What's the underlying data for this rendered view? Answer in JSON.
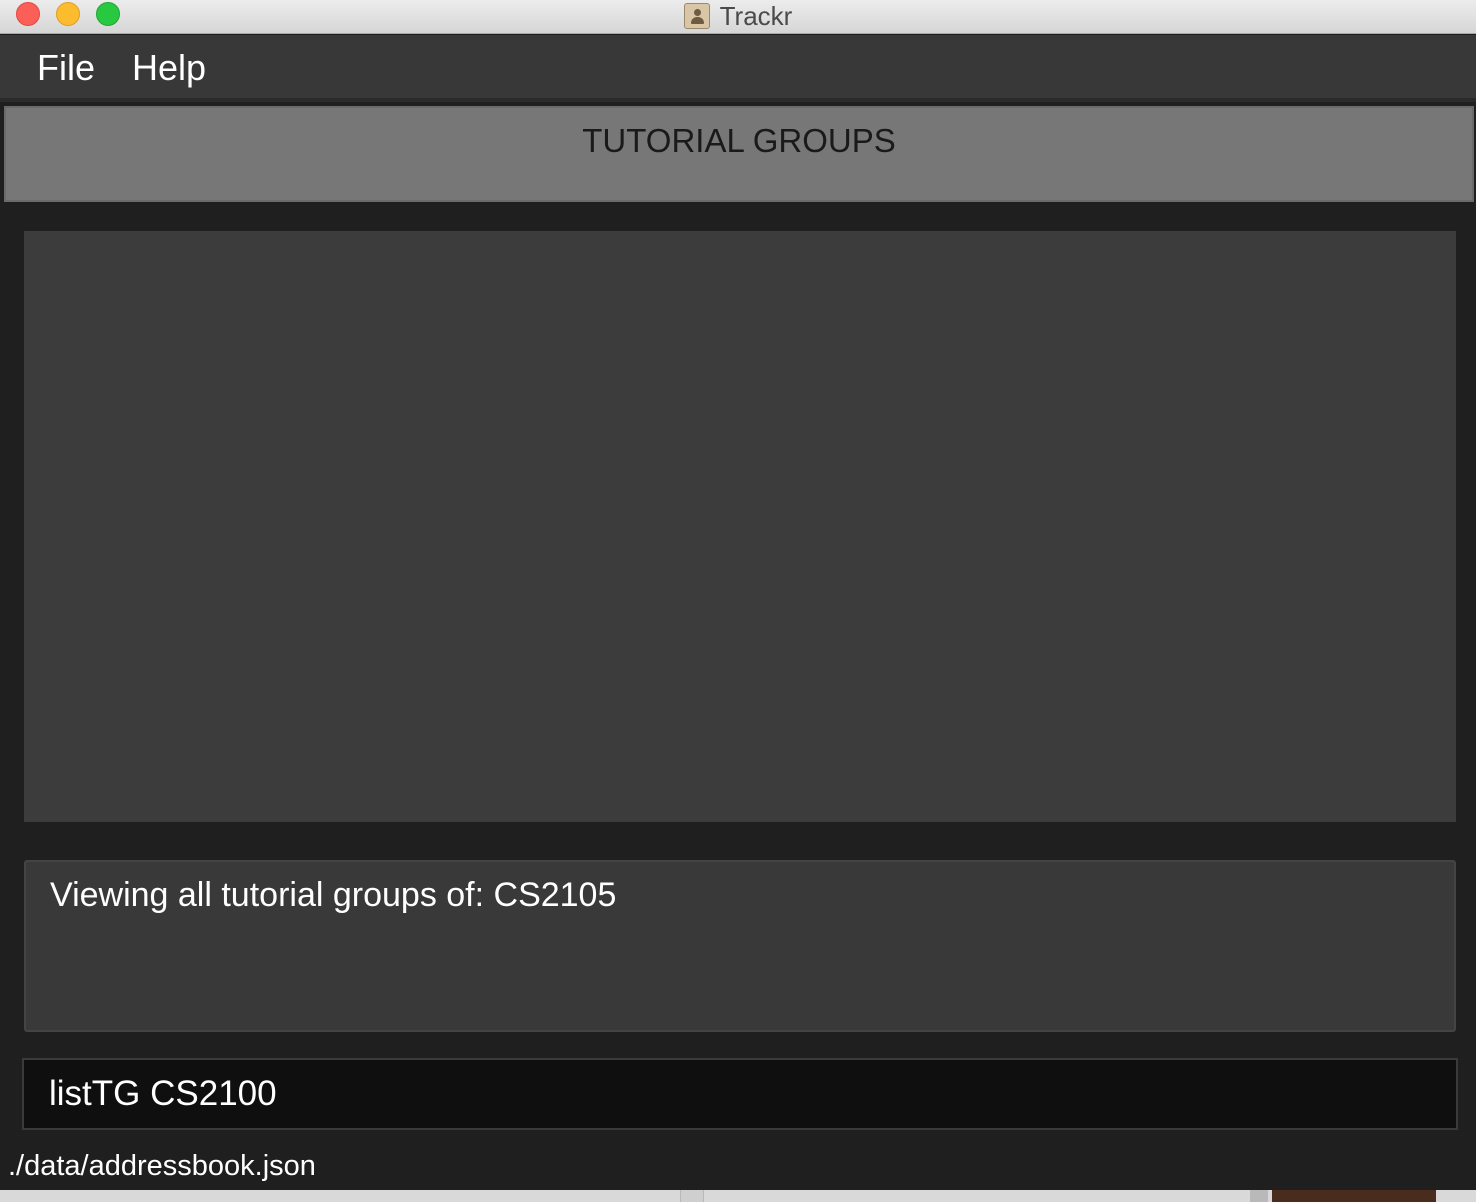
{
  "window": {
    "title": "Trackr"
  },
  "menu": {
    "file_label": "File",
    "help_label": "Help"
  },
  "section": {
    "title": "TUTORIAL GROUPS"
  },
  "result": {
    "message": "Viewing all tutorial groups of: CS2105"
  },
  "command": {
    "value": "listTG CS2100"
  },
  "status": {
    "file_path": "./data/addressbook.json"
  },
  "colors": {
    "menubar_bg": "#383838",
    "header_bg": "#777777",
    "panel_bg": "#3c3c3c",
    "command_bg": "#0f0f0f",
    "window_bg": "#1f1f1f"
  }
}
